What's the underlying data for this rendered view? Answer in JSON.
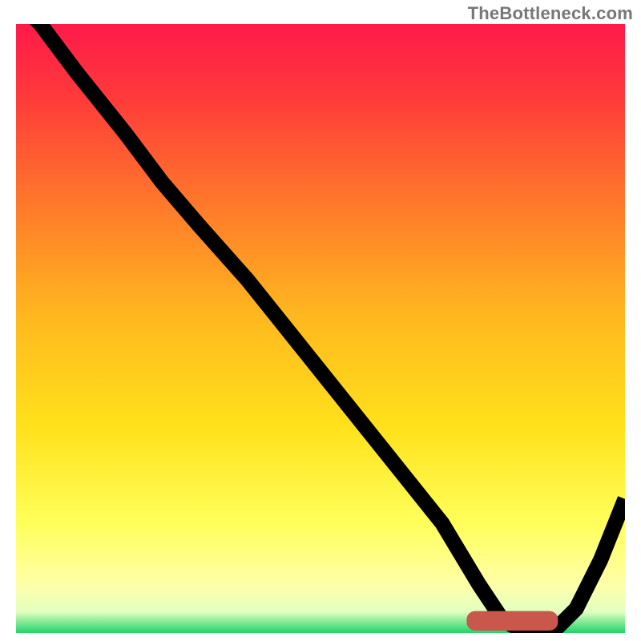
{
  "watermark": "TheBottleneck.com",
  "chart_data": {
    "type": "line",
    "title": "",
    "xlabel": "",
    "ylabel": "",
    "xlim": [
      0,
      100
    ],
    "ylim": [
      0,
      100
    ],
    "grid": false,
    "legend": false,
    "gradient_stops": [
      {
        "offset": 0.0,
        "color": "#ff1a4a"
      },
      {
        "offset": 0.12,
        "color": "#ff3a3a"
      },
      {
        "offset": 0.3,
        "color": "#ff7a2a"
      },
      {
        "offset": 0.48,
        "color": "#ffb81f"
      },
      {
        "offset": 0.66,
        "color": "#ffe11a"
      },
      {
        "offset": 0.82,
        "color": "#ffff5a"
      },
      {
        "offset": 0.92,
        "color": "#ffffa8"
      },
      {
        "offset": 0.965,
        "color": "#e3ffc0"
      },
      {
        "offset": 1.0,
        "color": "#1fd36a"
      }
    ],
    "series": [
      {
        "name": "bottleneck-curve",
        "x": [
          0,
          4,
          10,
          18,
          24,
          30,
          38,
          46,
          54,
          62,
          70,
          76,
          80,
          84,
          88,
          92,
          96,
          100
        ],
        "y": [
          104,
          100,
          92,
          82,
          74,
          67,
          58,
          48,
          38,
          28,
          18,
          8,
          2,
          0,
          0,
          4,
          12,
          22
        ]
      }
    ],
    "annotations": [
      {
        "name": "optimal-marker",
        "shape": "hbar",
        "x_start": 75,
        "x_end": 88,
        "y": 2,
        "color": "#c9574c"
      }
    ]
  }
}
